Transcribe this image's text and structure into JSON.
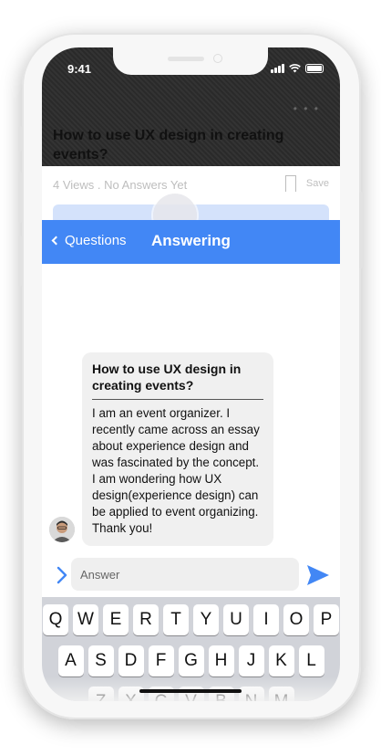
{
  "status_bar": {
    "time": "9:41"
  },
  "background_question": {
    "title": "How to use UX design in creating events?",
    "views": "4 Views",
    "answers": "No Answers Yet",
    "save_label": "Save"
  },
  "navbar": {
    "back_label": "Questions",
    "title": "Answering",
    "color": "#4287f5"
  },
  "message": {
    "title": "How to use UX design in creating events?",
    "body": "I am an event organizer. I recently came across an essay about experience design and was fascinated by the concept. I am wondering how UX design(experience design) can be applied to event organizing. Thank you!"
  },
  "composer": {
    "placeholder": "Answer",
    "expand_icon": "chevron-right-icon",
    "send_icon": "send-icon"
  },
  "keyboard": {
    "row1": [
      "Q",
      "W",
      "E",
      "R",
      "T",
      "Y",
      "U",
      "I",
      "O",
      "P"
    ],
    "row2": [
      "A",
      "S",
      "D",
      "F",
      "G",
      "H",
      "J",
      "K",
      "L"
    ],
    "row3": [
      "Z",
      "X",
      "C",
      "V",
      "B",
      "N",
      "M"
    ]
  }
}
